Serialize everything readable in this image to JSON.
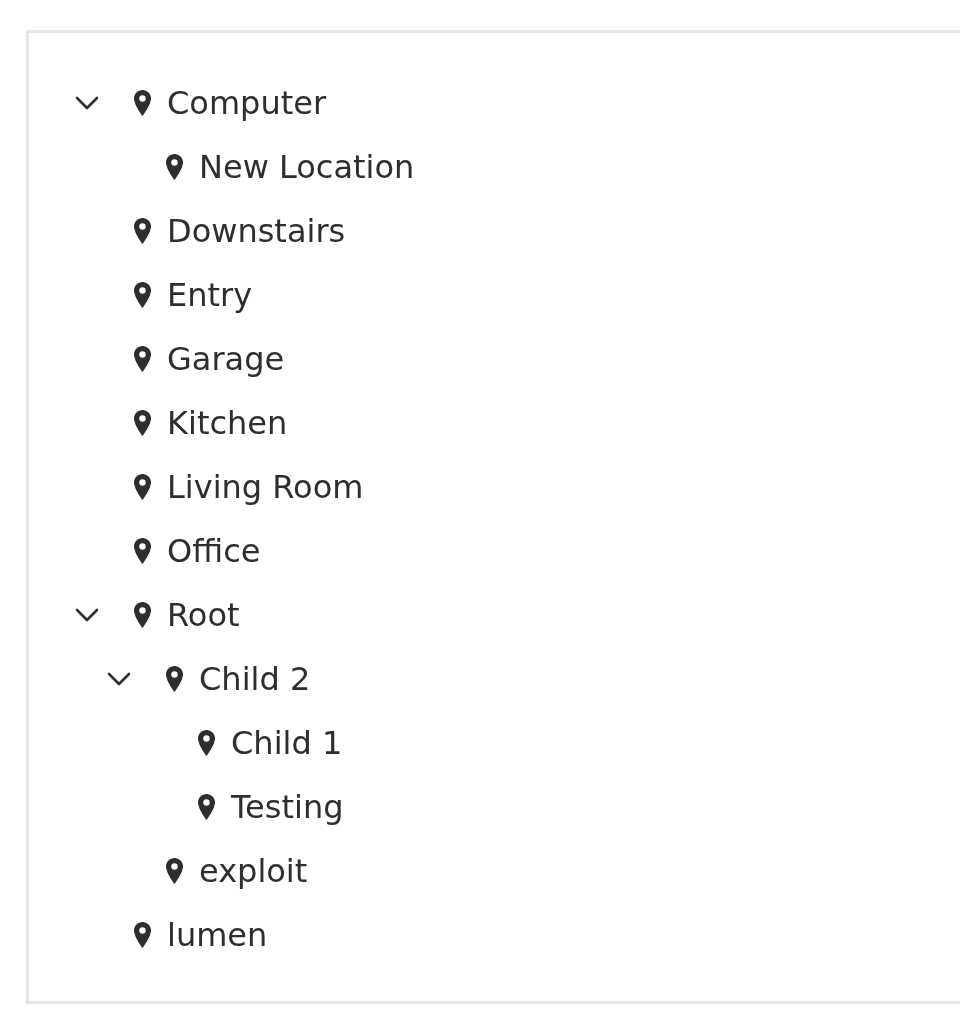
{
  "location_tree": [
    {
      "label": "Computer",
      "expanded": true,
      "children": [
        {
          "label": "New Location"
        }
      ]
    },
    {
      "label": "Downstairs"
    },
    {
      "label": "Entry"
    },
    {
      "label": "Garage"
    },
    {
      "label": "Kitchen"
    },
    {
      "label": "Living Room"
    },
    {
      "label": "Office"
    },
    {
      "label": "Root",
      "expanded": true,
      "children": [
        {
          "label": "Child 2",
          "expanded": true,
          "children": [
            {
              "label": "Child 1"
            },
            {
              "label": "Testing"
            }
          ]
        },
        {
          "label": "exploit"
        }
      ]
    },
    {
      "label": "lumen"
    }
  ]
}
